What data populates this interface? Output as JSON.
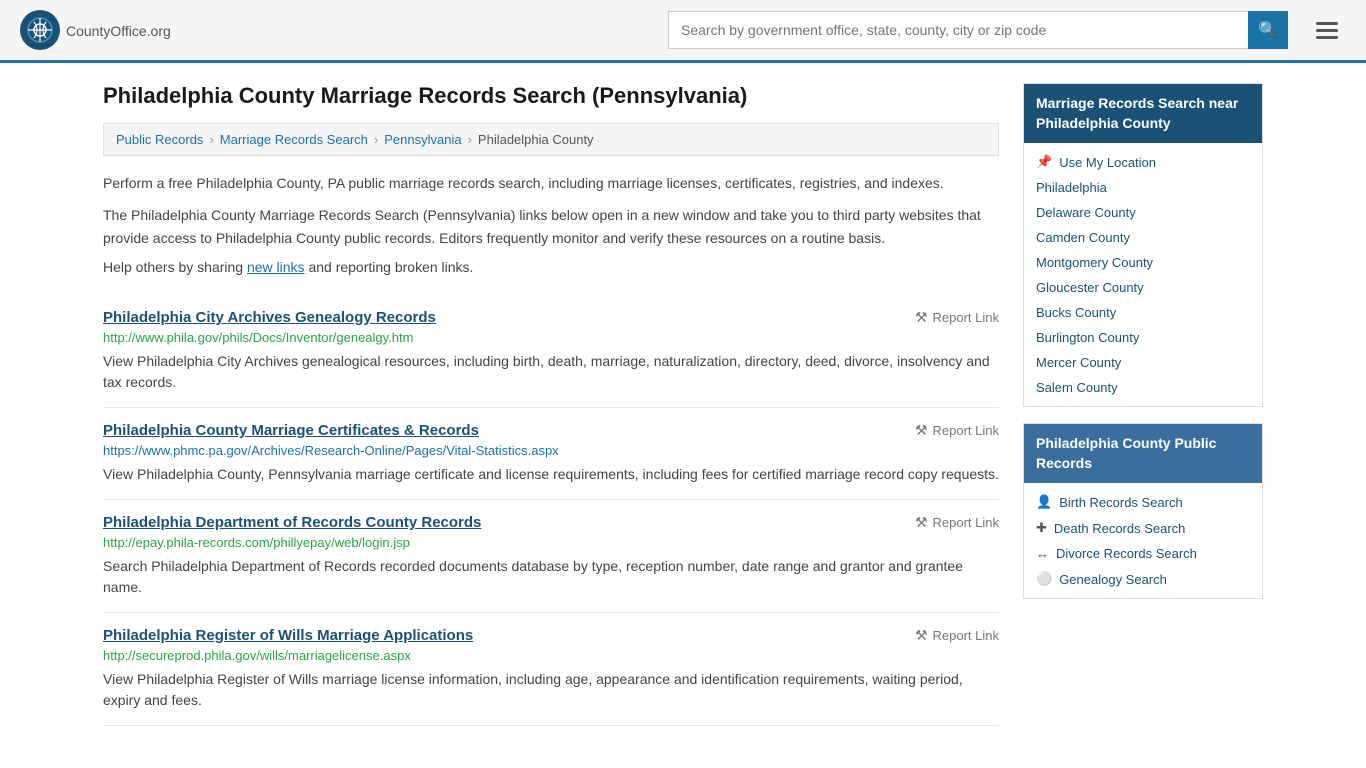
{
  "header": {
    "logo_text": "CountyOffice",
    "logo_suffix": ".org",
    "search_placeholder": "Search by government office, state, county, city or zip code"
  },
  "page": {
    "title": "Philadelphia County Marriage Records Search (Pennsylvania)",
    "breadcrumb": [
      {
        "label": "Public Records",
        "url": "#"
      },
      {
        "label": "Marriage Records Search",
        "url": "#"
      },
      {
        "label": "Pennsylvania",
        "url": "#"
      },
      {
        "label": "Philadelphia County",
        "url": "#"
      }
    ],
    "description1": "Perform a free Philadelphia County, PA public marriage records search, including marriage licenses, certificates, registries, and indexes.",
    "description2": "The Philadelphia County Marriage Records Search (Pennsylvania) links below open in a new window and take you to third party websites that provide access to Philadelphia County public records. Editors frequently monitor and verify these resources on a routine basis.",
    "help_text_prefix": "Help others by sharing ",
    "help_text_link": "new links",
    "help_text_suffix": " and reporting broken links."
  },
  "records": [
    {
      "title": "Philadelphia City Archives Genealogy Records",
      "url": "http://www.phila.gov/phils/Docs/Inventor/genealgy.htm",
      "url_color": "green",
      "description": "View Philadelphia City Archives genealogical resources, including birth, death, marriage, naturalization, directory, deed, divorce, insolvency and tax records.",
      "report_label": "Report Link"
    },
    {
      "title": "Philadelphia County Marriage Certificates & Records",
      "url": "https://www.phmc.pa.gov/Archives/Research-Online/Pages/Vital-Statistics.aspx",
      "url_color": "blue",
      "description": "View Philadelphia County, Pennsylvania marriage certificate and license requirements, including fees for certified marriage record copy requests.",
      "report_label": "Report Link"
    },
    {
      "title": "Philadelphia Department of Records County Records",
      "url": "http://epay.phila-records.com/phillyepay/web/login.jsp",
      "url_color": "green",
      "description": "Search Philadelphia Department of Records recorded documents database by type, reception number, date range and grantor and grantee name.",
      "report_label": "Report Link"
    },
    {
      "title": "Philadelphia Register of Wills Marriage Applications",
      "url": "http://secureprod.phila.gov/wills/marriagelicense.aspx",
      "url_color": "green",
      "description": "View Philadelphia Register of Wills marriage license information, including age, appearance and identification requirements, waiting period, expiry and fees.",
      "report_label": "Report Link"
    }
  ],
  "sidebar": {
    "nearby_header": "Marriage Records Search near Philadelphia County",
    "nearby_links": [
      {
        "label": "Use My Location",
        "icon": "location"
      },
      {
        "label": "Philadelphia",
        "icon": "none"
      },
      {
        "label": "Delaware County",
        "icon": "none"
      },
      {
        "label": "Camden County",
        "icon": "none"
      },
      {
        "label": "Montgomery County",
        "icon": "none"
      },
      {
        "label": "Gloucester County",
        "icon": "none"
      },
      {
        "label": "Bucks County",
        "icon": "none"
      },
      {
        "label": "Burlington County",
        "icon": "none"
      },
      {
        "label": "Mercer County",
        "icon": "none"
      },
      {
        "label": "Salem County",
        "icon": "none"
      }
    ],
    "public_records_header": "Philadelphia County Public Records",
    "public_records_links": [
      {
        "label": "Birth Records Search",
        "icon": "person"
      },
      {
        "label": "Death Records Search",
        "icon": "cross"
      },
      {
        "label": "Divorce Records Search",
        "icon": "arrows"
      },
      {
        "label": "Genealogy Search",
        "icon": "question"
      }
    ]
  }
}
